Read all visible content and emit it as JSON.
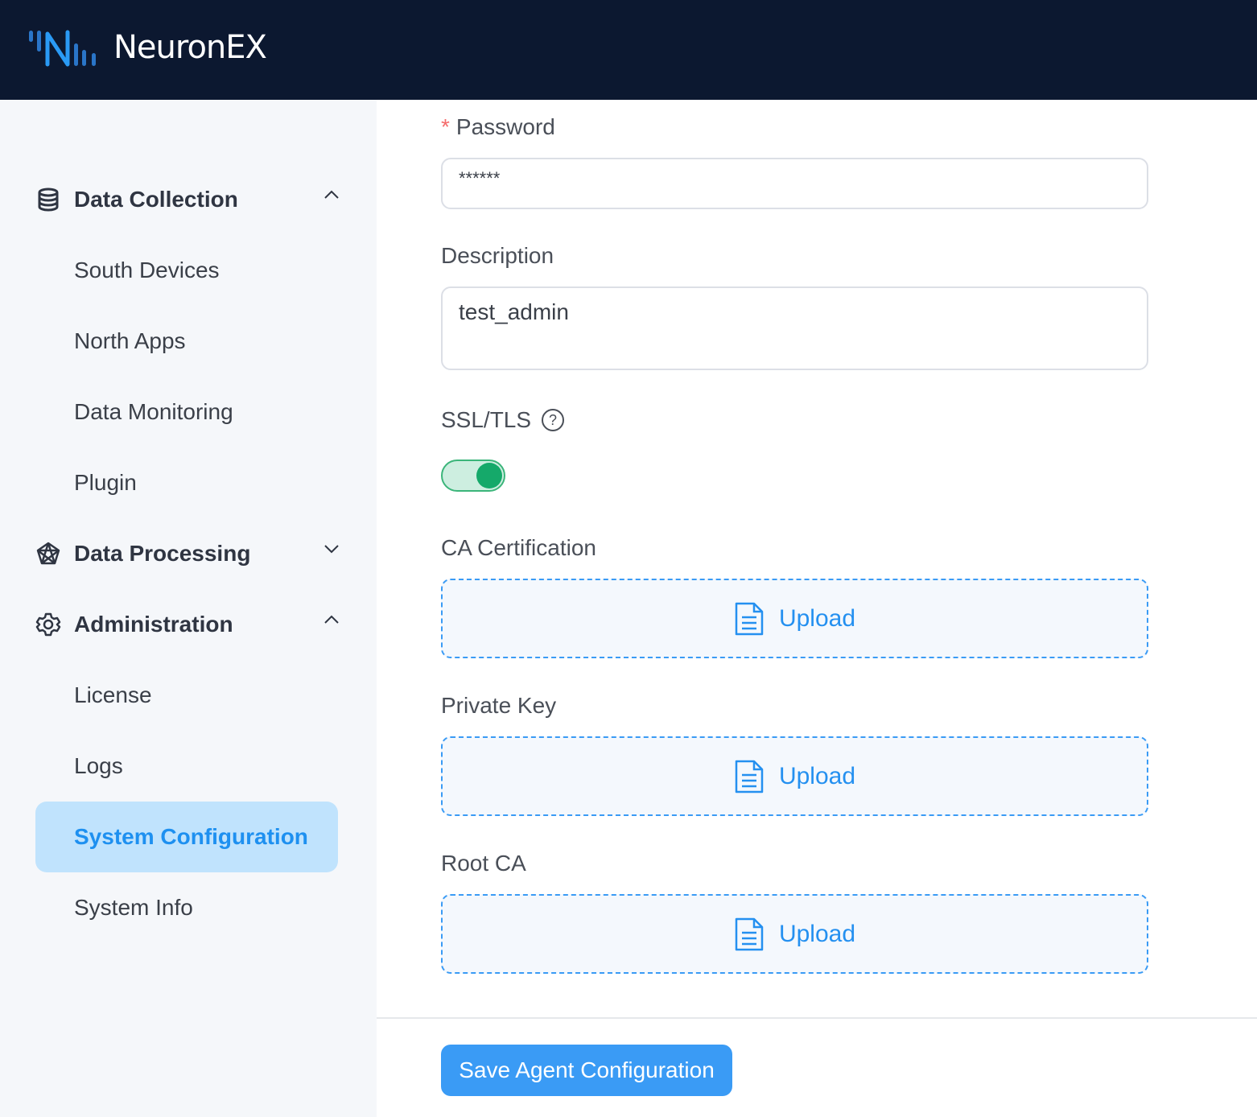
{
  "header": {
    "brand": "NeuronEX"
  },
  "sidebar": {
    "groups": [
      {
        "label": "Data Collection",
        "icon": "database-icon",
        "expanded": true
      },
      {
        "label": "Data Processing",
        "icon": "network-icon",
        "expanded": false
      },
      {
        "label": "Administration",
        "icon": "gear-icon",
        "expanded": true
      }
    ],
    "items": [
      {
        "label": "South Devices"
      },
      {
        "label": "North Apps"
      },
      {
        "label": "Data Monitoring"
      },
      {
        "label": "Plugin"
      },
      {
        "label": "License"
      },
      {
        "label": "Logs"
      },
      {
        "label": "System Configuration",
        "active": true
      },
      {
        "label": "System Info"
      }
    ]
  },
  "form": {
    "password_label": "Password",
    "required_mark": "*",
    "password_value": "******",
    "description_label": "Description",
    "description_value": "test_admin",
    "ssl_label": "SSL/TLS",
    "ssl_enabled": true,
    "ca_label": "CA Certification",
    "key_label": "Private Key",
    "root_label": "Root CA",
    "upload_label": "Upload",
    "save_label": "Save Agent Configuration"
  },
  "colors": {
    "accent": "#3a9bf5",
    "header": "#0c1830",
    "toggle": "#15a96a"
  }
}
